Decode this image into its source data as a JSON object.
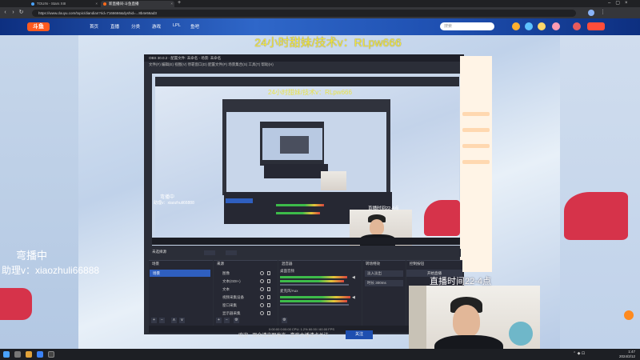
{
  "browser": {
    "tabs": [
      {
        "label": "TOUIN - Stars XIII",
        "active": false
      },
      {
        "label": "新直播间-斗鱼直播",
        "active": true
      }
    ],
    "url": "https://www.douyu.com/topic/diandian?rid=7166666&dyshid=...8b4e56ad3"
  },
  "site": {
    "logo": "斗鱼",
    "nav": [
      "首页",
      "直播",
      "分类",
      "游戏",
      "LPL",
      "鱼吧"
    ],
    "search_placeholder": "搜索"
  },
  "overlays": {
    "title": "24小时甜妹/技术v：RLpw666",
    "left_line1": "弯播中",
    "left_line2": "助理v：xiaozhuli66888",
    "right_line": "直播时间22-4点"
  },
  "inner": {
    "window_title": "OBS 30.0.2 - 配置文件: 未命名 - 场景: 未命名",
    "menu": "文件(F)  编辑(E)  视图(V)  停靠窗口(D)  配置文件(P)  场景集合(S)  工具(T)  帮助(H)",
    "title": "24小时甜妹/技术v：RLpw666",
    "left_line1": "弯播中",
    "left_line2": "助理v：xiaozhuli66888",
    "right_line": "直播时间22-4点"
  },
  "obs": {
    "scene_bar": "未选择源",
    "docks": {
      "scenes": "场景",
      "sources": "来源",
      "mixer": "混音器",
      "transitions": "转场特效",
      "controls": "控制按钮"
    },
    "scene_item": "场景",
    "sources": [
      "图像",
      "文本(GDI+)",
      "文本",
      "视频采集设备",
      "窗口采集",
      "显示器采集"
    ],
    "mixer": {
      "track1": "桌面音频",
      "track2": "麦克风/Aux"
    },
    "transitions": [
      "淡入淡出",
      "时长 300ms"
    ],
    "controls": [
      "开始直播",
      "开始录制",
      "启动虚拟摄像机",
      "工作室模式",
      "设置",
      "退出"
    ],
    "status": "0:00:00   0:00:00   CPU: 1.2%   60.00 / 60.00 FPS"
  },
  "page": {
    "bottom_caption": "欢迎 · 观众请文明发言 · 喜欢主播请点关注",
    "follow_button": "关注"
  },
  "taskbar": {
    "time": "1:47",
    "date": "2024/2/12"
  }
}
